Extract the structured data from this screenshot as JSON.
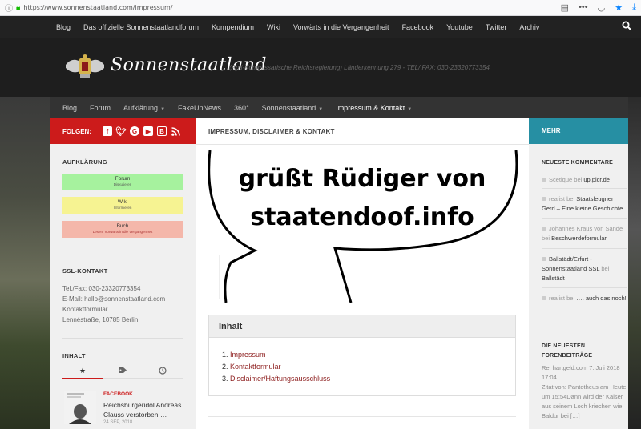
{
  "browser": {
    "url": "https://www.sonnenstaatland.com/impressum/"
  },
  "top_nav": {
    "items": [
      "Blog",
      "Das offizielle Sonnenstaatlandforum",
      "Kompendium",
      "Wiki",
      "Vorwärts in die Vergangenheit",
      "Facebook",
      "Youtube",
      "Twitter",
      "Archiv"
    ]
  },
  "header": {
    "site_name": "Sonnenstaatland",
    "tagline": "(Anti-Kommissarische Reichsregierung) Länderkennung 279 - TEL/ FAX: 030-23320773354"
  },
  "main_nav": {
    "items": [
      {
        "label": "Blog"
      },
      {
        "label": "Forum"
      },
      {
        "label": "Aufklärung"
      },
      {
        "label": "FakeUpNews"
      },
      {
        "label": "360°"
      },
      {
        "label": "Sonnenstaatland"
      },
      {
        "label": "Impressum & Kontakt"
      }
    ]
  },
  "left_sidebar": {
    "follow_label": "FOLGEN:",
    "social_icons": [
      "facebook-icon",
      "twitter-icon",
      "google-plus-icon",
      "youtube-icon",
      "blogger-icon",
      "rss-icon"
    ],
    "aufklaerung_heading": "AUFKLÄRUNG",
    "buttons": [
      {
        "title": "Forum",
        "subtitle": "Diskutieren",
        "color": "#a6f29e"
      },
      {
        "title": "Wiki",
        "subtitle": "Informieren",
        "color": "#f6f392"
      },
      {
        "title": "Buch",
        "subtitle": "Lesen: Vorwärts in die Vergangenheit",
        "color": "#f4b7aa"
      }
    ],
    "ssl_heading": "SSL-KONTAKT",
    "contact": {
      "phone": "Tel./Fax: 030-23320773354",
      "email": "E-Mail: hallo@sonnenstaatland.com",
      "form": "Kontaktformular",
      "address": "Lennéstraße, 10785 Berlin"
    },
    "inhalt_heading": "INHALT",
    "tabs": [
      "star-icon",
      "tag-icon",
      "clock-icon"
    ],
    "post": {
      "category": "FACEBOOK",
      "title": "Reichsbürgeridol Andreas Clauss verstorben …",
      "date": "24 SEP, 2018"
    }
  },
  "content": {
    "title": "IMPRESSUM, DISCLAIMER & KONTAKT",
    "bubble_line1": "grüßt Rüdiger von",
    "bubble_line2": "staatendoof.info",
    "toc_heading": "Inhalt",
    "toc": [
      {
        "num": "1.",
        "label": "Impressum"
      },
      {
        "num": "2.",
        "label": "Kontaktformular"
      },
      {
        "num": "3.",
        "label": "Disclaimer/Haftungsausschluss"
      }
    ]
  },
  "right_sidebar": {
    "mehr_label": "MEHR",
    "comments_heading": "NEUESTE KOMMENTARE",
    "comments": [
      {
        "author": "Scetique",
        "sep": "bei",
        "target": "up.picr.de"
      },
      {
        "author": "realist",
        "sep": "bei",
        "target": "Staatsleugner Gerd – Eine kleine Geschichte"
      },
      {
        "author": "Johannes Kraus von Sande",
        "sep": "bei",
        "target": "Beschwerdeformular"
      },
      {
        "author": "Ballstädt/Erfurt - Sonnenstaatland SSL",
        "sep": "bei",
        "target": "Ballstädt"
      },
      {
        "author": "realist",
        "sep": "bei",
        "target": "…. auch das noch!"
      }
    ],
    "forum_heading_1": "DIE NEUESTEN",
    "forum_heading_2": "FORENBEITRÄGE",
    "forum_post": {
      "line1": "Re: hartgeld.com 7. Juli 2018 17:04",
      "line2": "Zitat von: Pantotheus am Heute um 15:54Dann wird der Kaiser aus seinem Loch kriechen wie Baldur bei […]"
    }
  }
}
